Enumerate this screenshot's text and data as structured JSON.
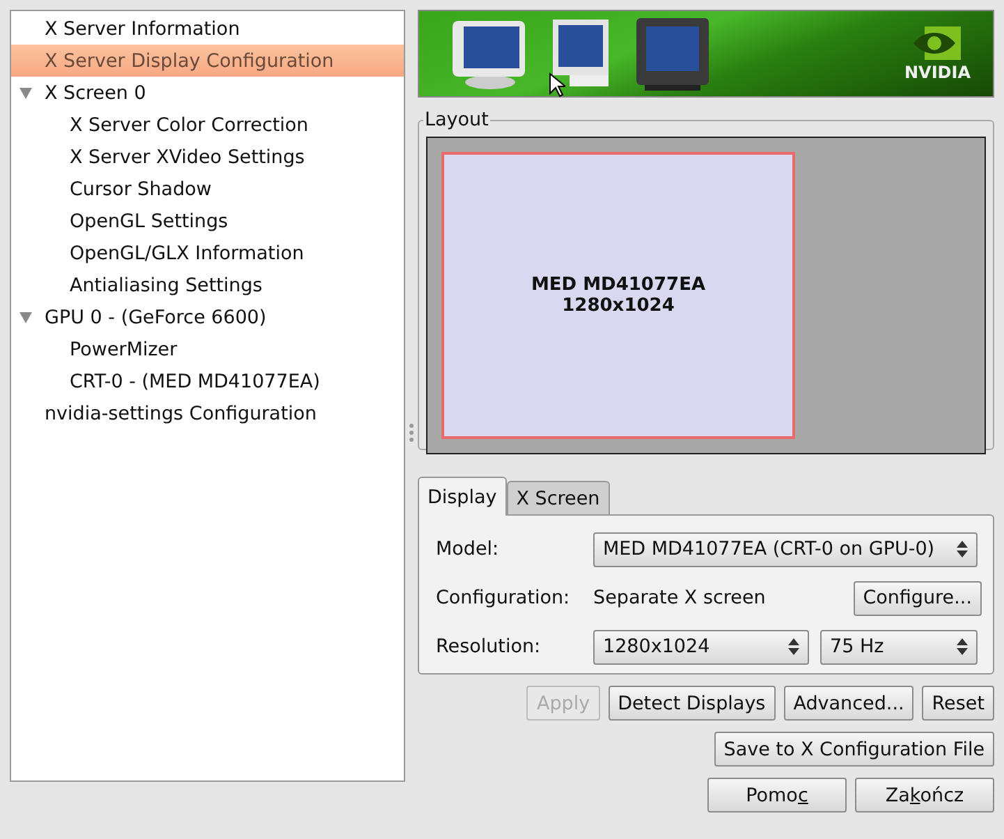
{
  "tree": [
    {
      "label": "X Server Information",
      "selected": false
    },
    {
      "label": "X Server Display Configuration",
      "selected": true
    },
    {
      "label": "X Screen 0",
      "selected": false,
      "expanded": true,
      "children": [
        {
          "label": "X Server Color Correction",
          "selected": false
        },
        {
          "label": "X Server XVideo Settings",
          "selected": false
        },
        {
          "label": "Cursor Shadow",
          "selected": false
        },
        {
          "label": "OpenGL Settings",
          "selected": false
        },
        {
          "label": "OpenGL/GLX Information",
          "selected": false
        },
        {
          "label": "Antialiasing Settings",
          "selected": false
        }
      ]
    },
    {
      "label": "GPU 0 - (GeForce 6600)",
      "selected": false,
      "expanded": true,
      "children": [
        {
          "label": "PowerMizer",
          "selected": false
        },
        {
          "label": "CRT-0 - (MED MD41077EA)",
          "selected": false
        }
      ]
    },
    {
      "label": "nvidia-settings Configuration",
      "selected": false
    }
  ],
  "banner": {
    "logo": "NVIDIA"
  },
  "layout": {
    "title": "Layout",
    "display": {
      "name": "MED MD41077EA",
      "resolution": "1280x1024"
    }
  },
  "tabs": [
    {
      "label": "Display",
      "selected": true
    },
    {
      "label": "X Screen",
      "selected": false
    }
  ],
  "form": {
    "model_label": "Model:",
    "model": "MED MD41077EA (CRT-0 on GPU-0)",
    "configuration_label": "Configuration:",
    "configuration": "Separate X screen",
    "configure_button": "Configure...",
    "resolution_label": "Resolution:",
    "resolution": "1280x1024",
    "refresh": "75 Hz"
  },
  "action_buttons": [
    {
      "label": "Apply",
      "disabled": true
    },
    {
      "label": "Detect Displays",
      "disabled": false
    },
    {
      "label": "Advanced...",
      "disabled": false
    },
    {
      "label": "Reset",
      "disabled": false
    }
  ],
  "save_button": "Save to X Configuration File",
  "dialog_buttons": [
    {
      "before": "Pomo",
      "key": "c"
    },
    {
      "before": "Za",
      "key": "k",
      "after": "ończ"
    }
  ]
}
